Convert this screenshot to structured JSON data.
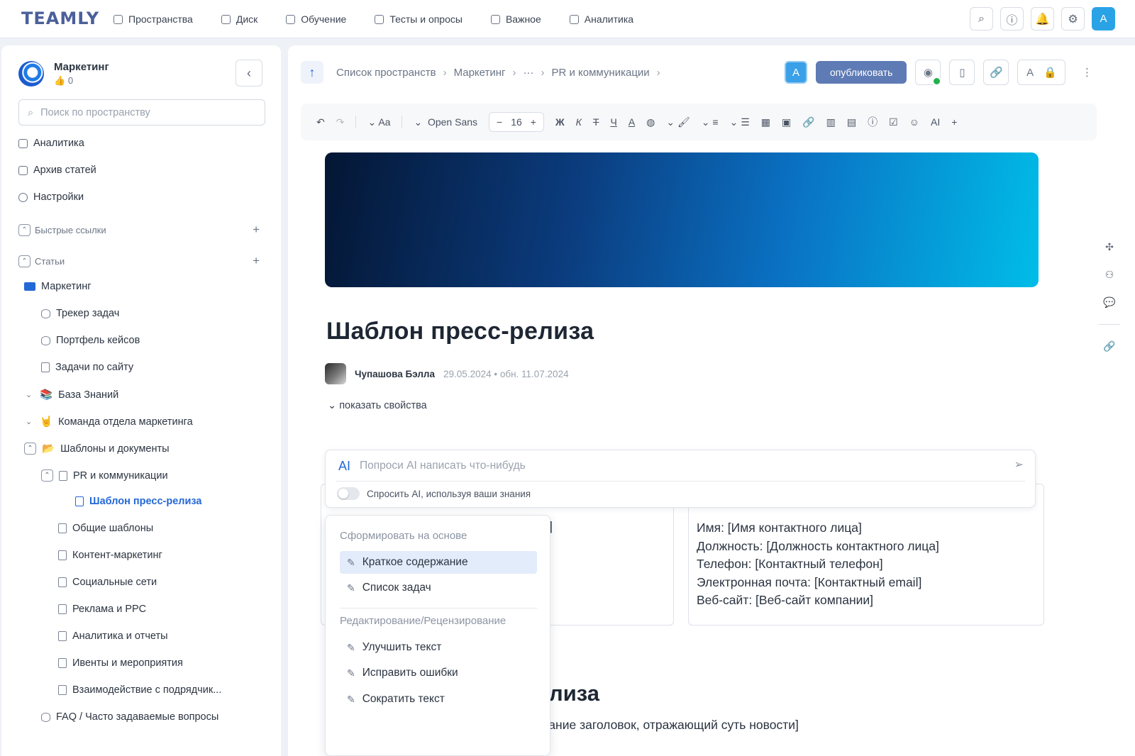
{
  "app": {
    "logo": "TEAMLY"
  },
  "nav": [
    {
      "label": "Пространства",
      "icon": "spaces-icon"
    },
    {
      "label": "Диск",
      "icon": "folder-icon"
    },
    {
      "label": "Обучение",
      "icon": "education-icon"
    },
    {
      "label": "Тесты и опросы",
      "icon": "tests-icon"
    },
    {
      "label": "Важное",
      "icon": "bookmark-icon"
    },
    {
      "label": "Аналитика",
      "icon": "analytics-icon"
    }
  ],
  "top_actions": {
    "search": "⌕",
    "info": "ⓘ",
    "bell": "🔔",
    "settings": "⚙",
    "avatar": "A"
  },
  "sidebar": {
    "space_name": "Маркетинг",
    "likes": "0",
    "search_placeholder": "Поиск по пространству",
    "links": [
      "Аналитика",
      "Архив статей",
      "Настройки"
    ],
    "quick_links": "Быстрые ссылки",
    "articles": "Статьи",
    "tree": [
      "Маркетинг",
      "Трекер задач",
      "Портфель кейсов",
      "Задачи по сайту",
      "База Знаний",
      "Команда отдела маркетинга",
      "Шаблоны и документы",
      "PR и коммуникации",
      "Шаблон пресс-релиза",
      "Общие шаблоны",
      "Контент-маркетинг",
      "Социальные сети",
      "Реклама и PPC",
      "Аналитика и отчеты",
      "Ивенты и мероприятия",
      "Взаимодействие с подрядчик...",
      "FAQ / Часто задаваемые вопросы"
    ]
  },
  "breadcrumb": [
    "Список пространств",
    "Маркетинг",
    "···",
    "PR и коммуникации"
  ],
  "doc_actions": {
    "badge": "A",
    "publish": "опубликовать",
    "font_a": "A"
  },
  "toolbar": {
    "font": "Open Sans",
    "size": "16",
    "aa": "Aa",
    "bold": "Ж",
    "italic": "К",
    "strike": "Т",
    "underline": "Ч",
    "color": "A",
    "ai": "AI"
  },
  "doc": {
    "title": "Шаблон пресс-релиза",
    "author": "Чупашова Бэлла",
    "dates": "29.05.2024 • обн. 11.07.2024",
    "show_props": "показать свойства"
  },
  "ai": {
    "label": "AI",
    "placeholder": "Попроси AI написать что-нибудь",
    "toggle_label": "Спросить AI, используя ваши знания"
  },
  "menu": {
    "group1": "Сформировать на основе",
    "items1": [
      "Краткое содержание",
      "Список задач"
    ],
    "group2": "Редактирование/Рецензирование",
    "items2": [
      "Улучшить текст",
      "Исправить ошибки",
      "Сократить текст"
    ]
  },
  "content": {
    "bracket": "]",
    "contact": [
      "Имя: [Имя контактного лица]",
      "Должность: [Должность контактного лица]",
      "Телефон: [Контактный телефон]",
      "Электронная почта: [Контактный email]",
      "Веб-сайт: [Веб-сайт компании]"
    ],
    "heading_fragment": "лиза",
    "bottom_text": "[Краткий, яркий и привлекающий внимание заголовок, отражающий суть новости]"
  }
}
